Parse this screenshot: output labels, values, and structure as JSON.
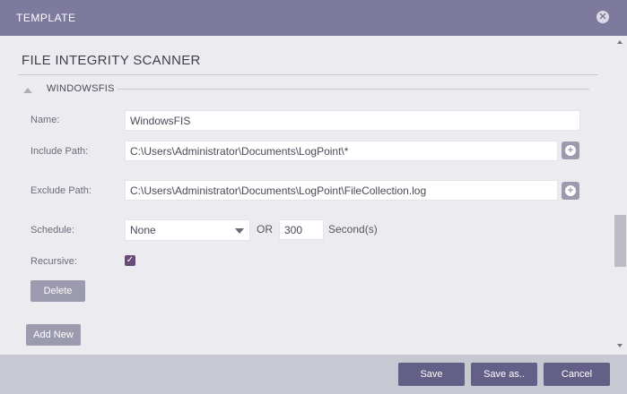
{
  "window": {
    "title": "TEMPLATE",
    "close_icon": "close-icon"
  },
  "section": {
    "title": "FILE INTEGRITY SCANNER"
  },
  "group": {
    "title": "WINDOWSFIS"
  },
  "form": {
    "name_label": "Name:",
    "name_value": "WindowsFIS",
    "include_label": "Include Path:",
    "include_value": "C:\\Users\\Administrator\\Documents\\LogPoint\\*",
    "exclude_label": "Exclude Path:",
    "exclude_value": "C:\\Users\\Administrator\\Documents\\LogPoint\\FileCollection.log",
    "schedule_label": "Schedule:",
    "schedule_value": "None",
    "or_text": "OR",
    "seconds_value": "300",
    "seconds_unit": "Second(s)",
    "recursive_label": "Recursive:",
    "recursive_checked": true,
    "delete_label": "Delete",
    "add_new_label": "Add New"
  },
  "footer": {
    "save": "Save",
    "save_as": "Save as..",
    "cancel": "Cancel"
  },
  "colors": {
    "titlebar": "#7d7a9e",
    "primary_button": "#635f86",
    "secondary_button": "#9b9aae",
    "checkbox": "#6a4a79"
  }
}
